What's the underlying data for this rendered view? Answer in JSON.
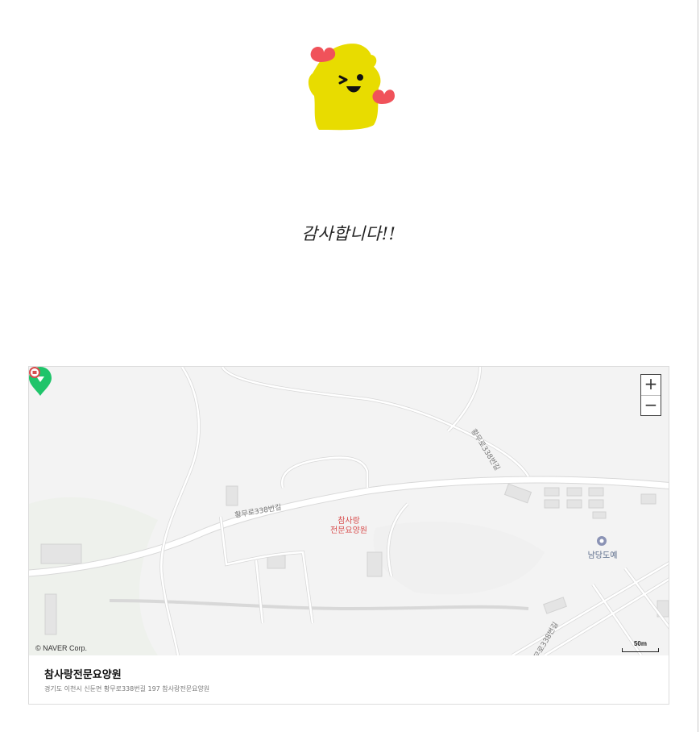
{
  "message": {
    "thanks": "감사합니다!!"
  },
  "map": {
    "zoom_in": "+",
    "zoom_out": "−",
    "copyright": "© NAVER Corp.",
    "scale_label": "50m",
    "road_labels": [
      "황무로338번길",
      "황무로338번길",
      "황무로338번길"
    ],
    "place_marker_label": "참사랑\n전문요양원",
    "poi_label": "남당도예"
  },
  "place": {
    "name": "참사랑전문요양원",
    "address": "경기도 이천시 신둔면 황무로338번길 197 참사랑전문요양원"
  },
  "colors": {
    "mascot": "#e8dc00",
    "heart": "#f0525a",
    "pin": "#1fc46a",
    "map_bg": "#f3f3f3",
    "road": "#ffffff"
  }
}
